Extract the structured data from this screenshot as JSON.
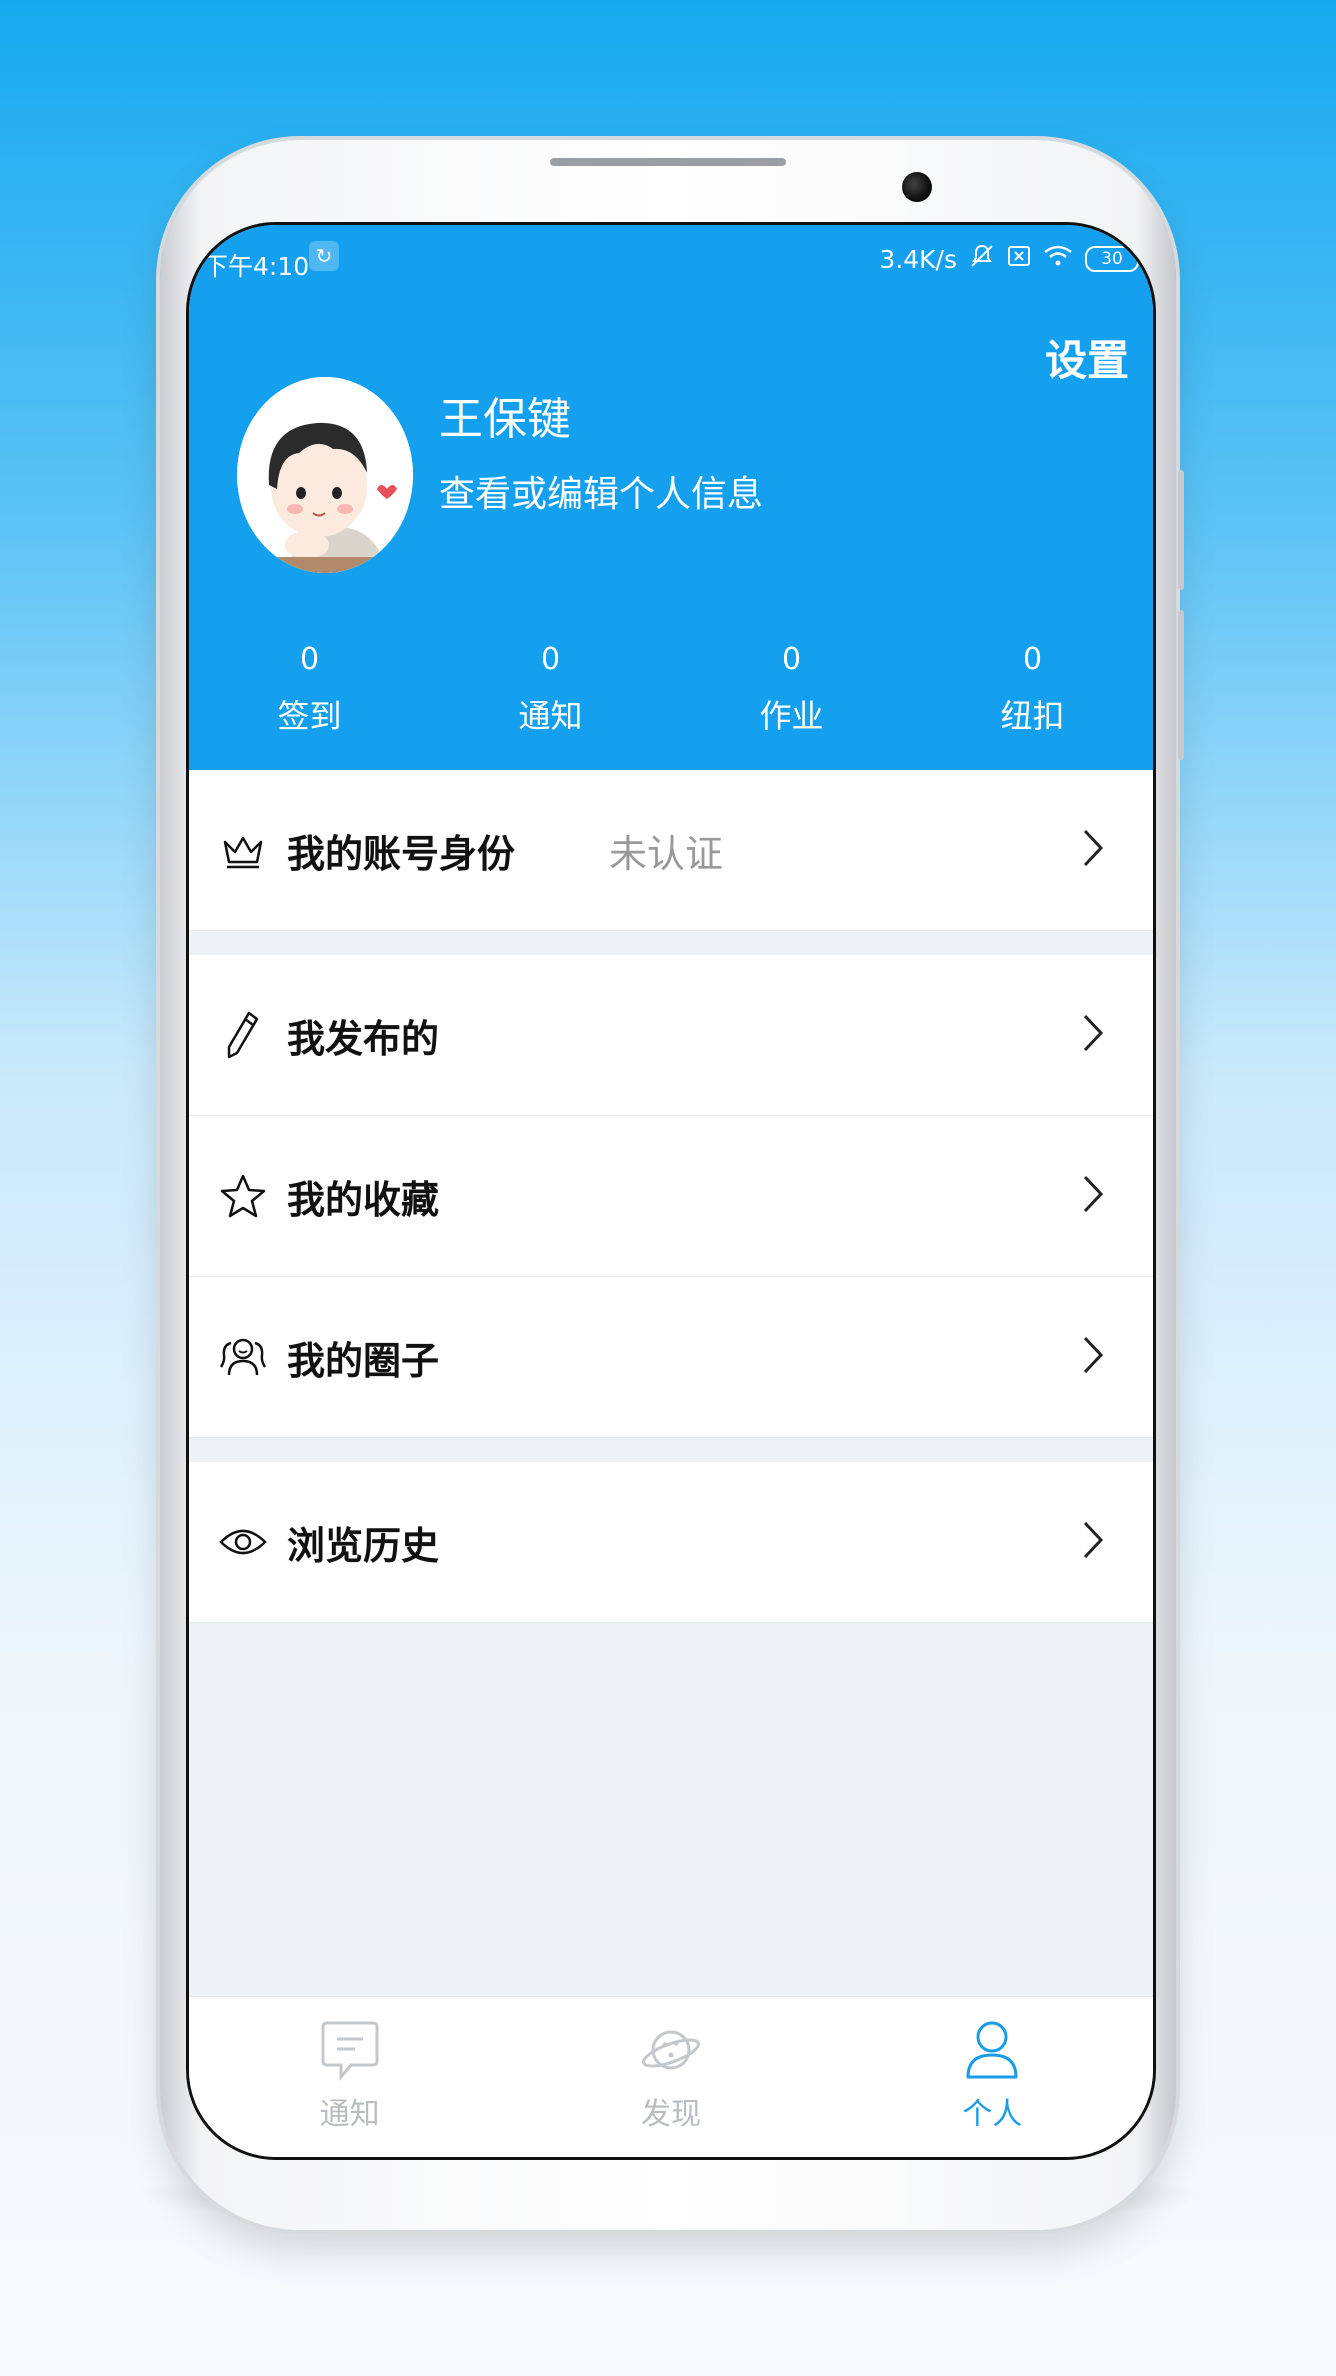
{
  "status_bar": {
    "time": "下午4:10",
    "network_speed": "3.4K/s",
    "battery": "30"
  },
  "header": {
    "settings_label": "设置",
    "username": "王保键",
    "edit_profile": "查看或编辑个人信息"
  },
  "stats": [
    {
      "value": "0",
      "label": "签到"
    },
    {
      "value": "0",
      "label": "通知"
    },
    {
      "value": "0",
      "label": "作业"
    },
    {
      "value": "0",
      "label": "纽扣"
    }
  ],
  "menu": {
    "account_identity": {
      "label": "我的账号身份",
      "status": "未认证",
      "icon": "crown-icon"
    },
    "my_posts": {
      "label": "我发布的",
      "icon": "pencil-icon"
    },
    "my_favorites": {
      "label": "我的收藏",
      "icon": "star-icon"
    },
    "my_circles": {
      "label": "我的圈子",
      "icon": "group-icon"
    },
    "browse_history": {
      "label": "浏览历史",
      "icon": "eye-icon"
    }
  },
  "tabbar": [
    {
      "label": "通知",
      "icon": "message-icon",
      "active": false
    },
    {
      "label": "发现",
      "icon": "planet-icon",
      "active": false
    },
    {
      "label": "个人",
      "icon": "person-icon",
      "active": true
    }
  ],
  "colors": {
    "primary": "#14a0ee",
    "tab_active": "#1a9be8",
    "tab_inactive": "#b9bcc0",
    "status_gray": "#999999"
  }
}
